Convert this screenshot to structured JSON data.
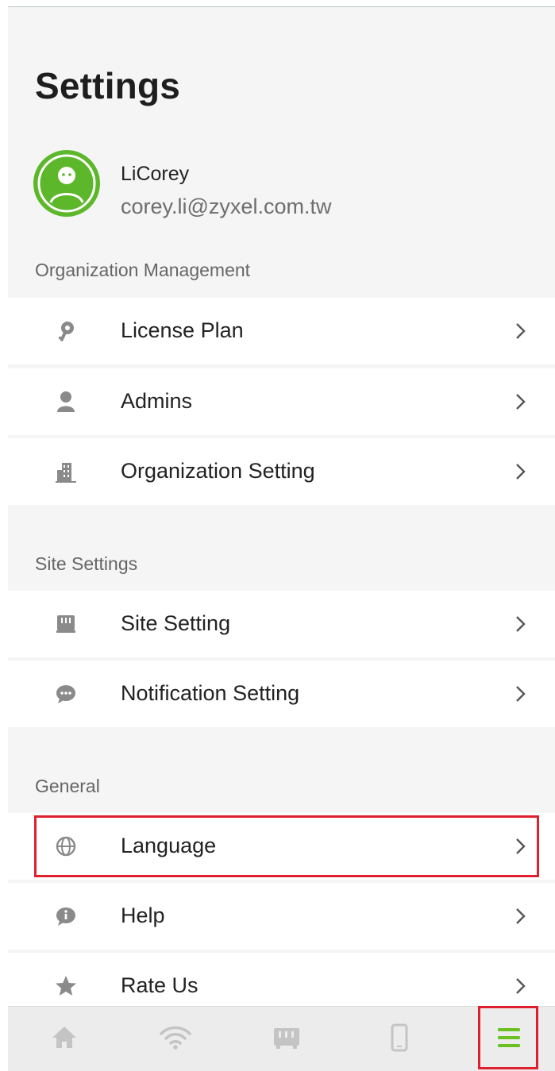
{
  "title": "Settings",
  "profile": {
    "name": "LiCorey",
    "email": "corey.li@zyxel.com.tw",
    "avatar_color": "#5cb82a"
  },
  "sections": {
    "organization": {
      "header": "Organization Management",
      "items": [
        {
          "label": "License Plan",
          "icon": "key-icon"
        },
        {
          "label": "Admins",
          "icon": "person-icon"
        },
        {
          "label": "Organization Setting",
          "icon": "building-icon"
        }
      ]
    },
    "site": {
      "header": "Site Settings",
      "items": [
        {
          "label": "Site Setting",
          "icon": "device-icon"
        },
        {
          "label": "Notification Setting",
          "icon": "chat-bubble-icon"
        }
      ]
    },
    "general": {
      "header": "General",
      "items": [
        {
          "label": "Language",
          "icon": "globe-icon"
        },
        {
          "label": "Help",
          "icon": "info-icon"
        },
        {
          "label": "Rate Us",
          "icon": "star-icon"
        }
      ]
    }
  },
  "bottom_nav": [
    {
      "name": "home-icon",
      "active": false
    },
    {
      "name": "wifi-icon",
      "active": false
    },
    {
      "name": "device-icon",
      "active": false
    },
    {
      "name": "phone-icon",
      "active": false
    },
    {
      "name": "menu-icon",
      "active": true
    }
  ],
  "colors": {
    "accent": "#6ac11f",
    "highlight": "#e0202e",
    "icon_gray": "#8a8a8a",
    "nav_inactive": "#bdbdbd"
  }
}
